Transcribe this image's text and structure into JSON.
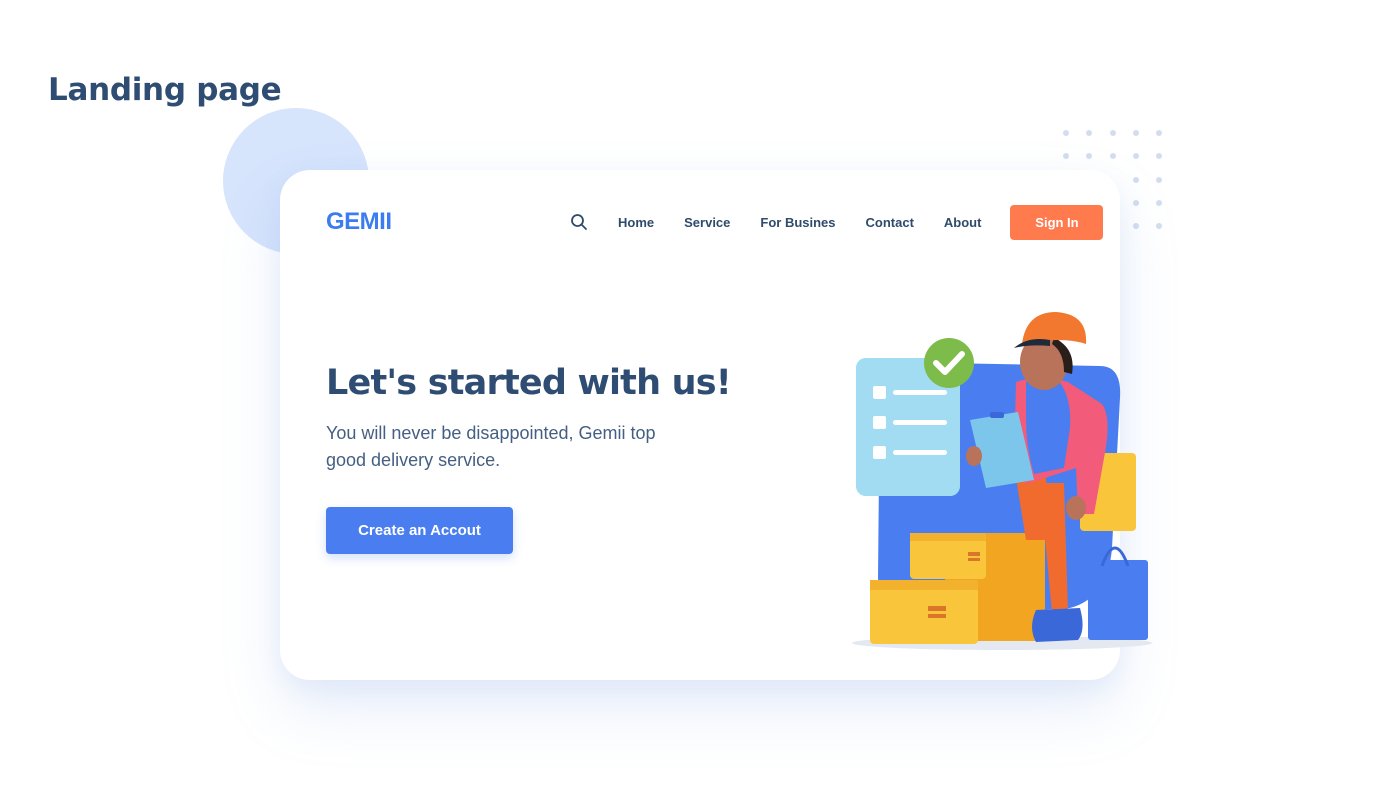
{
  "showcase": {
    "title": "Landing page"
  },
  "header": {
    "logo": "GEMII",
    "nav": [
      "Home",
      "Service",
      "For Busines",
      "Contact",
      "About"
    ],
    "sign_in_label": "Sign In"
  },
  "hero": {
    "heading": "Let's started with us!",
    "subtitle": "You will never be disappointed, Gemii top good delivery service.",
    "cta_label": "Create an Accout"
  },
  "colors": {
    "primary": "#4a7ef0",
    "accent": "#ff7a4d",
    "heading": "#2f4d72",
    "decor_circle": "#d6e4fc"
  },
  "icons": [
    "search-icon",
    "check-icon"
  ]
}
